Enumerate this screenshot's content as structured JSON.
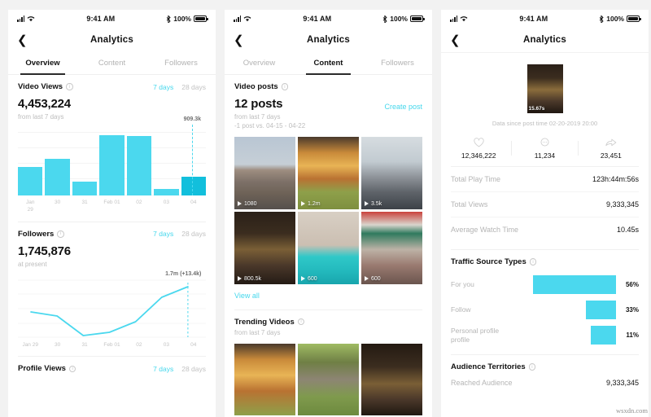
{
  "accent": "#45D7EC",
  "accent_bar": "#4BD8EE",
  "accent_bar_highlight": "#12BFDC",
  "statusbar": {
    "time": "9:41 AM",
    "battery": "100%"
  },
  "nav": {
    "title": "Analytics",
    "back_icon": "chevron-left-icon"
  },
  "tabs": [
    {
      "label": "Overview"
    },
    {
      "label": "Content"
    },
    {
      "label": "Followers"
    }
  ],
  "panel1": {
    "active_tab": "Overview",
    "video_views": {
      "title": "Video Views",
      "range_7": "7 days",
      "range_28": "28 days",
      "value": "4,453,224",
      "sub": "from last 7 days",
      "marker_label": "909.3k"
    },
    "followers": {
      "title": "Followers",
      "range_7": "7 days",
      "range_28": "28 days",
      "value": "1,745,876",
      "sub": "at present",
      "marker_label": "1.7m (+13.4k)"
    },
    "profile_views": {
      "title": "Profile Views",
      "range_7": "7 days",
      "range_28": "28 days"
    }
  },
  "panel2": {
    "active_tab": "Content",
    "video_posts": {
      "title": "Video posts",
      "count": "12 posts",
      "create": "Create post",
      "sub1": "from last 7 days",
      "sub2": "-1 post vs. 04-15 - 04-22",
      "view_all": "View all"
    },
    "videos": [
      {
        "views": "1080",
        "img": "city-street"
      },
      {
        "views": "1.2m",
        "img": "burger"
      },
      {
        "views": "3.5k",
        "img": "snow-crowd"
      },
      {
        "views": "800.5k",
        "img": "dark-corridor"
      },
      {
        "views": "600",
        "img": "venice-gondola"
      },
      {
        "views": "600",
        "img": "cafe-terrace"
      }
    ],
    "trending": {
      "title": "Trending Videos",
      "sub": "from last 7 days",
      "items": [
        {
          "img": "burger"
        },
        {
          "img": "deer"
        },
        {
          "img": "dark-corridor"
        }
      ]
    }
  },
  "panel3": {
    "thumb_duration": "15.67s",
    "since": "Data since post time 02-20-2019 20:00",
    "engagement": [
      {
        "icon": "heart-icon",
        "value": "12,346,222"
      },
      {
        "icon": "comment-icon",
        "value": "11,234"
      },
      {
        "icon": "share-icon",
        "value": "23,451"
      }
    ],
    "metrics": [
      {
        "label": "Total Play Time",
        "value": "123h:44m:56s"
      },
      {
        "label": "Total Views",
        "value": "9,333,345"
      },
      {
        "label": "Average Watch Time",
        "value": "10.45s"
      }
    ],
    "traffic": {
      "title": "Traffic Source Types",
      "rows": [
        {
          "name": "For you",
          "pct": "56%",
          "value": 56
        },
        {
          "name": "Follow",
          "pct": "33%",
          "value": 33
        },
        {
          "name": "Personal profile profile",
          "pct": "11%",
          "value": 11
        }
      ]
    },
    "audience": {
      "title": "Audience Territories",
      "row_label": "Reached Audience",
      "row_value": "9,333,345"
    }
  },
  "watermark": "wsxdn.com",
  "chart_data": [
    {
      "type": "bar",
      "title": "Video Views",
      "categories": [
        "Jan 29",
        "30",
        "31",
        "Feb 01",
        "02",
        "03",
        "04"
      ],
      "values": [
        430,
        555,
        210,
        909,
        890,
        95,
        290
      ],
      "ylabel": "",
      "xlabel": "",
      "ylim": [
        0,
        960
      ],
      "grid": true,
      "highlight_index": 6,
      "annotation": "909.3k"
    },
    {
      "type": "line",
      "title": "Followers",
      "x": [
        "Jan 29",
        "30",
        "31",
        "Feb 01",
        "02",
        "03",
        "04"
      ],
      "values": [
        0.45,
        0.38,
        0.03,
        0.1,
        0.28,
        0.7,
        0.88
      ],
      "ylabel": "",
      "xlabel": "",
      "grid": true,
      "annotation": "1.7m (+13.4k)"
    },
    {
      "type": "bar",
      "title": "Traffic Source Types",
      "categories": [
        "For you",
        "Follow",
        "Personal profile profile"
      ],
      "values": [
        56,
        33,
        11
      ],
      "ylabel": "",
      "xlabel": "%",
      "ylim": [
        0,
        100
      ],
      "orientation": "horizontal-right-aligned",
      "grid": false
    }
  ]
}
